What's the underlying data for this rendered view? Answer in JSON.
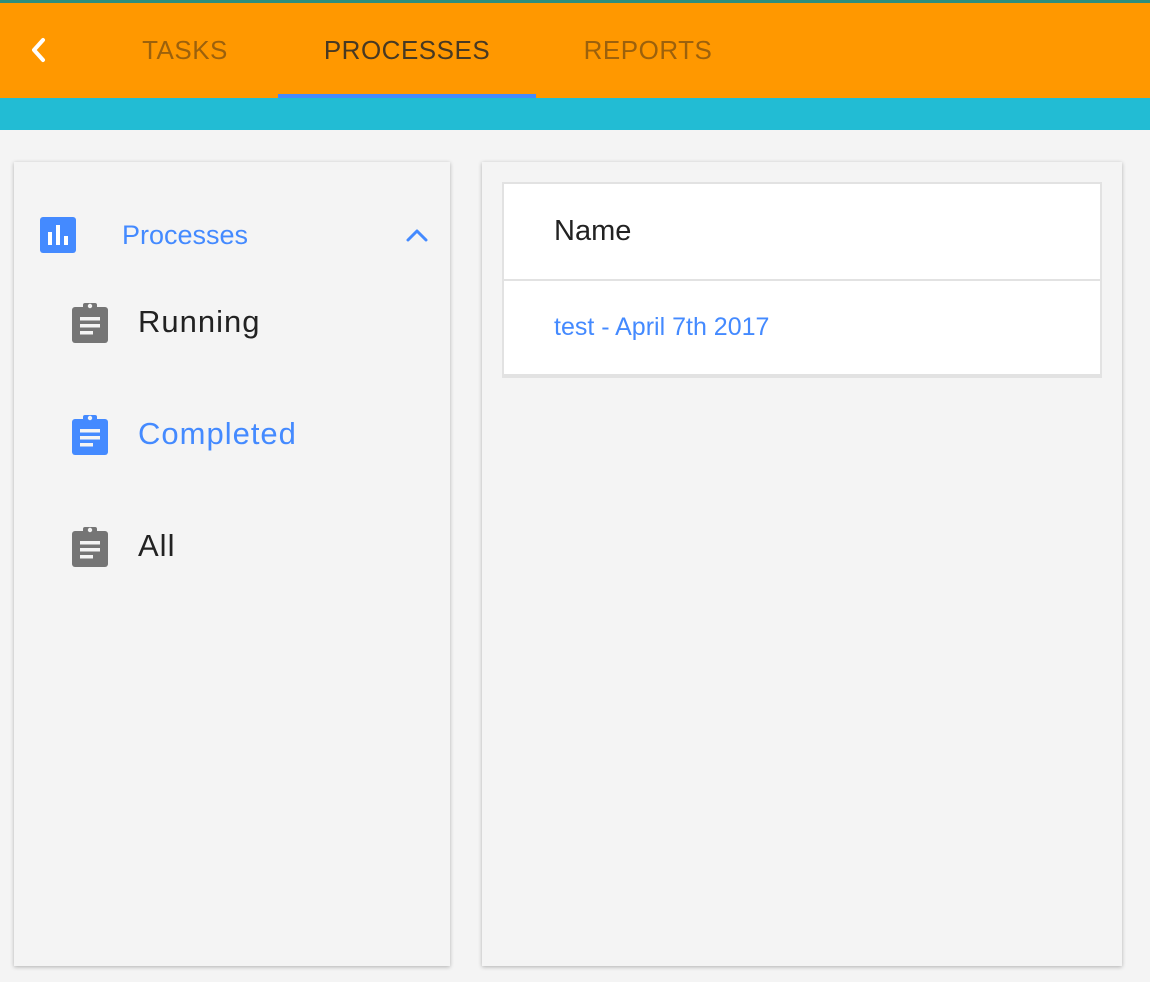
{
  "nav": {
    "tabs": [
      {
        "label": "TASKS",
        "active": false
      },
      {
        "label": "PROCESSES",
        "active": true
      },
      {
        "label": "REPORTS",
        "active": false
      }
    ]
  },
  "sidebar": {
    "group": {
      "label": "Processes",
      "icon": "bar-chart-icon",
      "expanded": true
    },
    "items": [
      {
        "label": "Running",
        "icon": "clipboard-icon",
        "active": false
      },
      {
        "label": "Completed",
        "icon": "clipboard-icon",
        "active": true
      },
      {
        "label": "All",
        "icon": "clipboard-icon",
        "active": false
      }
    ]
  },
  "table": {
    "headers": [
      "Name"
    ],
    "rows": [
      {
        "name": "test - April 7th 2017"
      }
    ]
  },
  "colors": {
    "topbar": "#ff9800",
    "subbar": "#22bcd4",
    "accent": "#448aff",
    "icon_gray": "#757575"
  }
}
